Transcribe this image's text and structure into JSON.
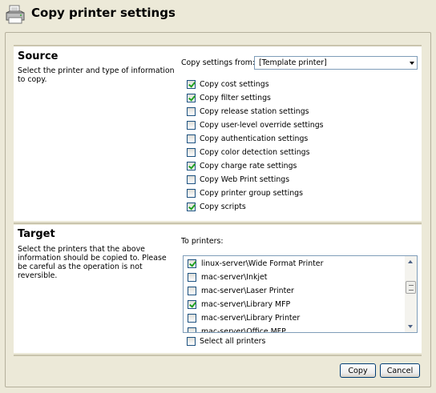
{
  "header": {
    "title": "Copy printer settings",
    "icon": "printer-icon"
  },
  "source": {
    "title": "Source",
    "description": "Select the printer and type of information to copy.",
    "copy_from_label": "Copy settings from:",
    "copy_from_value": "[Template printer]",
    "options": [
      {
        "label": "Copy cost settings",
        "checked": true
      },
      {
        "label": "Copy filter settings",
        "checked": true
      },
      {
        "label": "Copy release station settings",
        "checked": false
      },
      {
        "label": "Copy user-level override settings",
        "checked": false
      },
      {
        "label": "Copy authentication settings",
        "checked": false
      },
      {
        "label": "Copy color detection settings",
        "checked": false
      },
      {
        "label": "Copy charge rate settings",
        "checked": true
      },
      {
        "label": "Copy Web Print settings",
        "checked": false
      },
      {
        "label": "Copy printer group settings",
        "checked": false
      },
      {
        "label": "Copy scripts",
        "checked": true
      }
    ]
  },
  "target": {
    "title": "Target",
    "description": "Select the printers that the above information should be copied to. Please be careful as the operation is not reversible.",
    "to_label": "To printers:",
    "printers": [
      {
        "label": "linux-server\\Wide Format Printer",
        "checked": true
      },
      {
        "label": "mac-server\\Inkjet",
        "checked": false
      },
      {
        "label": "mac-server\\Laser Printer",
        "checked": false
      },
      {
        "label": "mac-server\\Library MFP",
        "checked": true
      },
      {
        "label": "mac-server\\Library Printer",
        "checked": false
      },
      {
        "label": "mac-server\\Office MFP",
        "checked": false
      }
    ],
    "select_all_label": "Select all printers",
    "select_all_checked": false
  },
  "buttons": {
    "copy": "Copy",
    "cancel": "Cancel"
  }
}
